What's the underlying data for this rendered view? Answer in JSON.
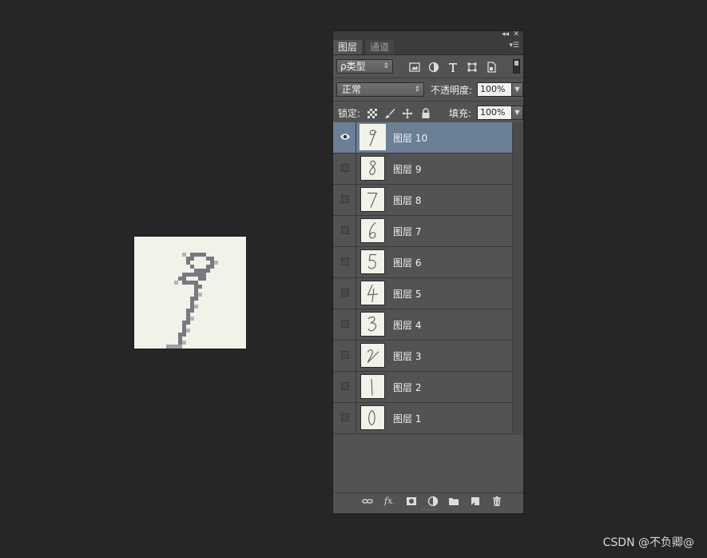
{
  "panel": {
    "tabs": [
      "图层",
      "通道"
    ],
    "filter": {
      "label": "ρ类型"
    },
    "blend_mode": "正常",
    "opacity_label": "不透明度:",
    "opacity_value": "100%",
    "lock_label": "锁定:",
    "fill_label": "填充:",
    "fill_value": "100%",
    "layers": [
      {
        "name": "图层 10",
        "digit": "9",
        "visible": true,
        "selected": true
      },
      {
        "name": "图层 9",
        "digit": "8",
        "visible": false,
        "selected": false
      },
      {
        "name": "图层 8",
        "digit": "7",
        "visible": false,
        "selected": false
      },
      {
        "name": "图层 7",
        "digit": "6",
        "visible": false,
        "selected": false
      },
      {
        "name": "图层 6",
        "digit": "5",
        "visible": false,
        "selected": false
      },
      {
        "name": "图层 5",
        "digit": "4",
        "visible": false,
        "selected": false
      },
      {
        "name": "图层 4",
        "digit": "3",
        "visible": false,
        "selected": false
      },
      {
        "name": "图层 3",
        "digit": "2",
        "visible": false,
        "selected": false
      },
      {
        "name": "图层 2",
        "digit": "1",
        "visible": false,
        "selected": false
      },
      {
        "name": "图层 1",
        "digit": "0",
        "visible": false,
        "selected": false
      }
    ],
    "footer_icons": [
      "link-icon",
      "fx-icon",
      "mask-icon",
      "adjustment-icon",
      "folder-icon",
      "new-layer-icon",
      "trash-icon"
    ]
  },
  "colors": {
    "selected_layer": "#6b7f97",
    "panel_bg": "#535353",
    "app_bg": "#262626"
  },
  "watermark": "CSDN @不负卿@"
}
